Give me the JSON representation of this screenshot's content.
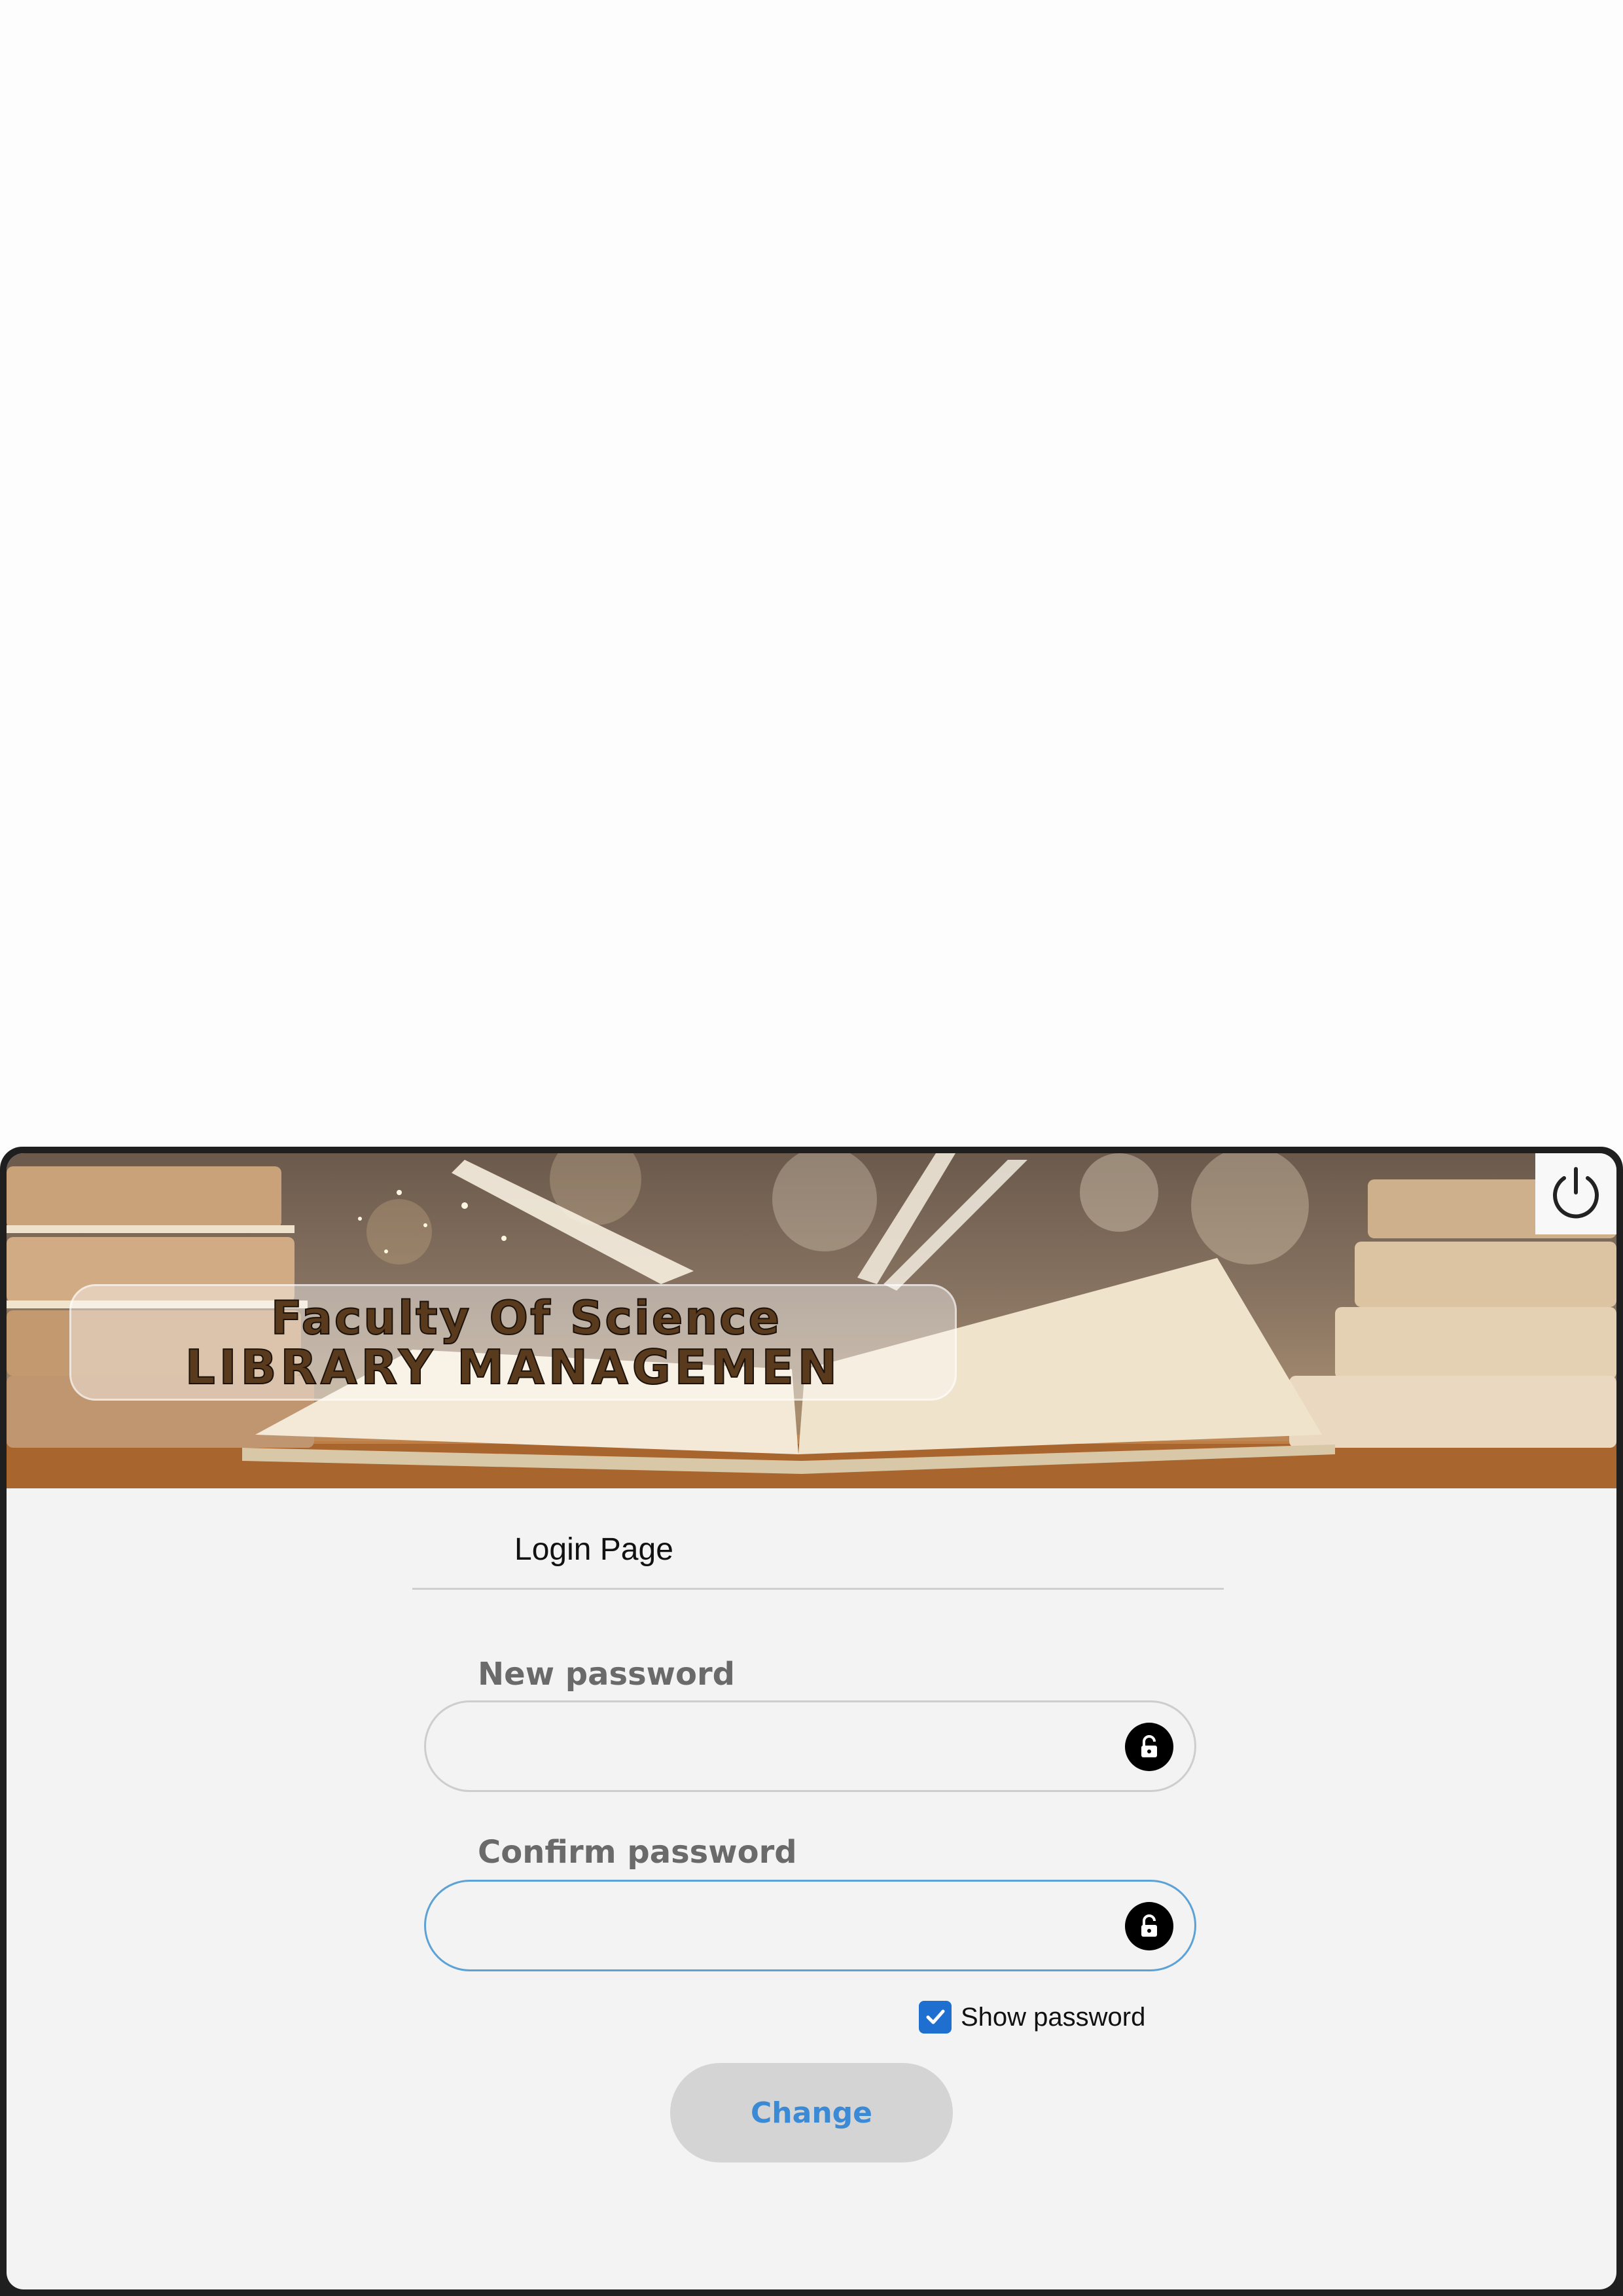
{
  "banner": {
    "title_line1": "Faculty Of Science",
    "title_line2": "LIBRARY MANAGEMEN"
  },
  "header": {
    "page_title": "Login Page"
  },
  "form": {
    "new_password": {
      "label": "New password",
      "value": ""
    },
    "confirm_password": {
      "label": "Confirm password",
      "value": ""
    },
    "show_password": {
      "label": "Show password",
      "checked": true
    },
    "submit_label": "Change"
  },
  "icons": {
    "power": "power-icon",
    "lock": "lock-icon",
    "check": "checkmark-icon"
  },
  "colors": {
    "accent": "#3a8ad6",
    "checkbox": "#1f6fd1",
    "focus_border": "#5da2d5",
    "button_bg": "#d4d4d4",
    "window_bg": "#f3f3f3"
  }
}
